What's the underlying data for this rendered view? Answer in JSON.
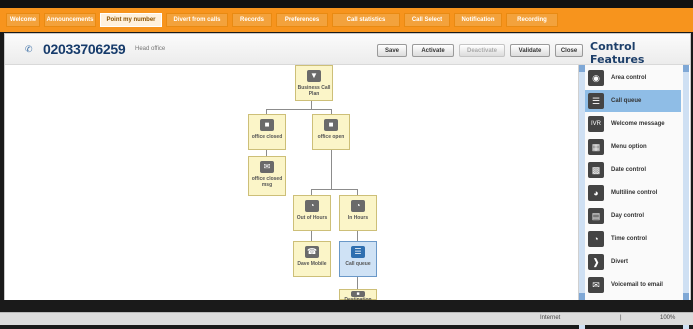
{
  "tabs": [
    {
      "label": "Welcome"
    },
    {
      "label": "Announcements"
    },
    {
      "label": "Point my number"
    },
    {
      "label": "Divert from calls"
    },
    {
      "label": "Records"
    },
    {
      "label": "Preferences"
    },
    {
      "label": "Call statistics"
    },
    {
      "label": "Call Select"
    },
    {
      "label": "Notification"
    },
    {
      "label": "Recording"
    }
  ],
  "header": {
    "number": "02033706259",
    "location": "Head office",
    "buttons": {
      "save": "Save",
      "activate": "Activate",
      "deactivate": "Deactivate",
      "validate": "Validate",
      "close": "Close"
    },
    "panel_title": "Control Features"
  },
  "flow": {
    "nodes": [
      {
        "label": "Business Call Plan",
        "icon": "plan-icon"
      },
      {
        "label": "office closed",
        "icon": "clock-icon"
      },
      {
        "label": "office open",
        "icon": "clock-icon"
      },
      {
        "label": "office closed msg",
        "icon": "message-icon"
      },
      {
        "label": "Out of Hours",
        "icon": "time-icon"
      },
      {
        "label": "In Hours",
        "icon": "time-icon"
      },
      {
        "label": "Dave Mobile",
        "icon": "phone-icon"
      },
      {
        "label": "Call queue",
        "icon": "queue-icon"
      },
      {
        "label": "Destination",
        "icon": "destination-icon"
      }
    ]
  },
  "control_features": [
    {
      "label": "Area control",
      "icon": "area-control-icon"
    },
    {
      "label": "Call queue",
      "icon": "call-queue-icon"
    },
    {
      "label": "Welcome message",
      "icon": "ivr-icon"
    },
    {
      "label": "Menu option",
      "icon": "menu-option-icon"
    },
    {
      "label": "Date control",
      "icon": "date-control-icon"
    },
    {
      "label": "Multiline control",
      "icon": "multiline-control-icon"
    },
    {
      "label": "Day control",
      "icon": "day-control-icon"
    },
    {
      "label": "Time control",
      "icon": "time-control-icon"
    },
    {
      "label": "Divert",
      "icon": "divert-icon"
    },
    {
      "label": "Voicemail to email",
      "icon": "voicemail-icon"
    }
  ],
  "status": {
    "zone": "Internet",
    "zoom_sep": "|",
    "zoom": "100%"
  },
  "colors": {
    "tab_bar": "#f7941d",
    "panel_selection": "#8fbde6",
    "node_fill": "#fbf5c8",
    "selected_node_fill": "#cfe2f5"
  }
}
